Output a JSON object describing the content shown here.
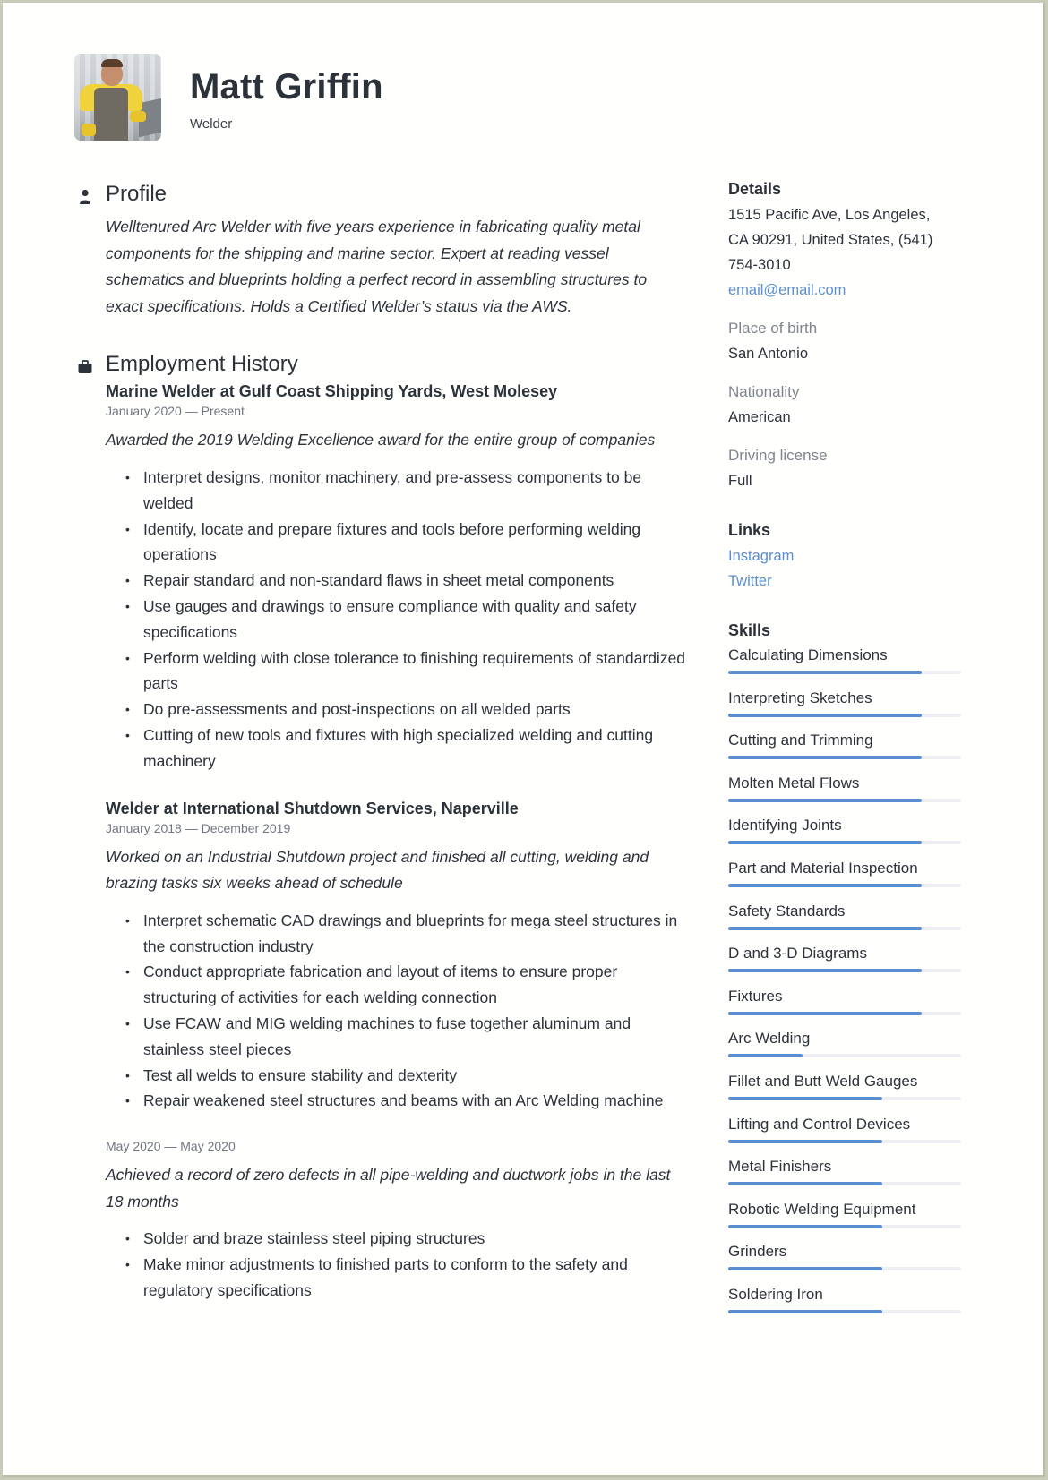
{
  "header": {
    "name": "Matt Griffin",
    "job_title": "Welder",
    "photo_alt": "profile-photo"
  },
  "profile": {
    "heading": "Profile",
    "icon": "person-icon",
    "text": "Welltenured Arc Welder with five years experience in fabricating quality metal components for the shipping and marine sector. Expert at reading vessel schematics and blueprints holding a perfect record in assembling structures to exact specifications. Holds a Certified Welder’s status via the AWS."
  },
  "employment": {
    "heading": "Employment History",
    "icon": "briefcase-icon",
    "jobs": [
      {
        "title": "Marine Welder at  Gulf Coast Shipping Yards, West Molesey",
        "dates": "January 2020 — Present",
        "summary": "Awarded the 2019 Welding Excellence award for the entire group of companies",
        "bullets": [
          "Interpret designs, monitor machinery, and pre-assess components to be welded",
          "Identify, locate and prepare fixtures and tools before performing welding operations",
          "Repair standard and non-standard flaws in sheet metal components",
          "Use gauges and drawings to ensure compliance with quality and safety specifications",
          "Perform welding with close tolerance to finishing requirements of standardized parts",
          "Do pre-assessments and post-inspections on all welded parts",
          "Cutting of new tools and fixtures with high specialized welding and cutting machinery"
        ]
      },
      {
        "title": "Welder at  International Shutdown Services, Naperville",
        "dates": "January 2018 — December 2019",
        "summary": "Worked on an Industrial Shutdown project and finished all cutting, welding and brazing tasks six weeks ahead of schedule",
        "bullets": [
          "Interpret schematic CAD drawings and blueprints for mega steel structures in the construction industry",
          "Conduct appropriate fabrication and layout of items to ensure proper structuring of activities for each welding connection",
          "Use FCAW and MIG welding machines to fuse together aluminum and stainless steel pieces",
          "Test all welds to ensure stability and dexterity",
          "Repair weakened steel structures and beams with an Arc Welding machine"
        ]
      },
      {
        "title": "",
        "dates": "May 2020 — May 2020",
        "summary": "Achieved a record of zero defects in all pipe-welding and ductwork jobs in the last 18 months",
        "bullets": [
          "Solder and braze stainless steel piping structures",
          "Make minor adjustments to finished parts to conform to the safety and regulatory specifications"
        ]
      }
    ]
  },
  "details": {
    "heading": "Details",
    "address_lines": [
      "1515 Pacific Ave, Los Angeles,",
      "CA 90291, United States, (541)",
      "754-3010"
    ],
    "email": "email@email.com",
    "place_of_birth_label": "Place of birth",
    "place_of_birth": "San Antonio",
    "nationality_label": "Nationality",
    "nationality": "American",
    "driving_license_label": "Driving license",
    "driving_license": "Full"
  },
  "links": {
    "heading": "Links",
    "items": [
      "Instagram",
      "Twitter"
    ]
  },
  "skills": {
    "heading": "Skills",
    "items": [
      {
        "name": "Calculating Dimensions",
        "level": 0.83
      },
      {
        "name": "Interpreting Sketches",
        "level": 0.83
      },
      {
        "name": "Cutting and Trimming",
        "level": 0.83
      },
      {
        "name": "Molten Metal Flows",
        "level": 0.83
      },
      {
        "name": "Identifying Joints",
        "level": 0.83
      },
      {
        "name": "Part and Material Inspection",
        "level": 0.83
      },
      {
        "name": "Safety Standards",
        "level": 0.83
      },
      {
        "name": "D and 3-D Diagrams",
        "level": 0.83
      },
      {
        "name": "Fixtures",
        "level": 0.83
      },
      {
        "name": "Arc Welding",
        "level": 0.32
      },
      {
        "name": "Fillet and Butt Weld Gauges",
        "level": 0.66
      },
      {
        "name": "Lifting and Control Devices",
        "level": 0.66
      },
      {
        "name": "Metal Finishers",
        "level": 0.66
      },
      {
        "name": "Robotic Welding Equipment",
        "level": 0.66
      },
      {
        "name": "Grinders",
        "level": 0.66
      },
      {
        "name": "Soldering Iron",
        "level": 0.66
      }
    ]
  },
  "colors": {
    "text": "#2c323a",
    "muted": "#7f858d",
    "link": "#5a8fd1",
    "skill_fill": "#5b8dd3",
    "skill_track": "#eceef2"
  }
}
